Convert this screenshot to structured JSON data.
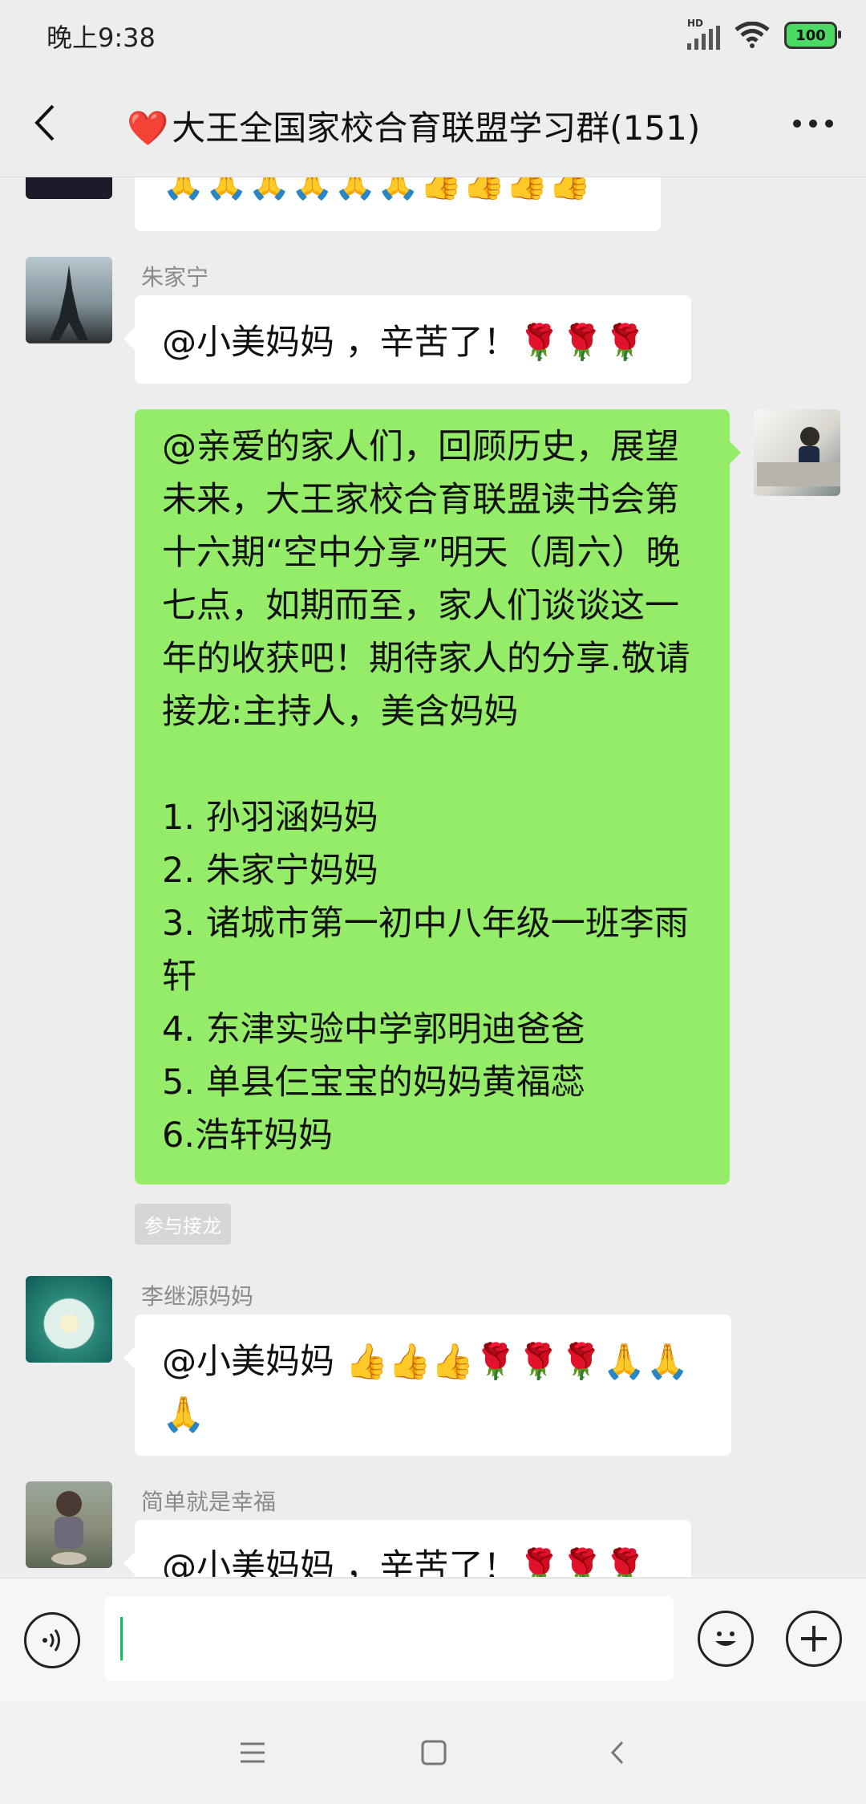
{
  "status": {
    "time": "晚上9:38",
    "network": "HD",
    "battery": "100"
  },
  "header": {
    "title_emoji": "❤️",
    "title": "大王全国家校合育联盟学习群(151)"
  },
  "messages": [
    {
      "type": "received",
      "sender": "",
      "text": "🙏🙏🙏🙏🙏🙏👍👍👍👍"
    },
    {
      "type": "received",
      "sender": "朱家宁",
      "text": "@小美妈妈 ，辛苦了！🌹🌹🌹"
    },
    {
      "type": "sent",
      "text": "@亲爱的家人们，回顾历史，展望未来，大王家校合育联盟读书会第十六期“空中分享”明天（周六）晚七点，如期而至，家人们谈谈这一年的收获吧！期待家人的分享.敬请接龙:主持人，美含妈妈\n\n1. 孙羽涵妈妈\n2. 朱家宁妈妈\n3. 诸城市第一初中八年级一班李雨轩\n4. 东津实验中学郭明迪爸爸\n5. 单县仨宝宝的妈妈黄福蕊\n6.浩轩妈妈",
      "tag": "参与接龙"
    },
    {
      "type": "received",
      "sender": "李继源妈妈",
      "text": "@小美妈妈  👍👍👍🌹🌹🌹🙏🙏🙏"
    },
    {
      "type": "received",
      "sender": "简单就是幸福",
      "text": "@小美妈妈 ，辛苦了！🌹🌹🌹"
    }
  ],
  "input": {
    "value": ""
  },
  "colors": {
    "chat_bg": "#ededed",
    "sent_bubble": "#95ec69",
    "received_bubble": "#ffffff",
    "accent": "#07c160"
  }
}
